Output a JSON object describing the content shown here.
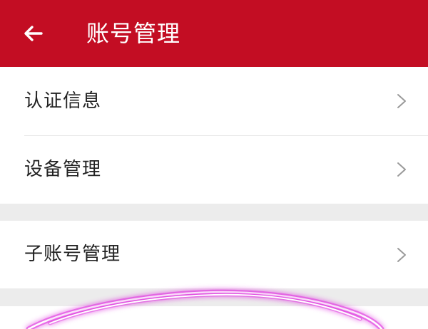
{
  "header": {
    "title": "账号管理",
    "back_icon": "arrow-left-icon",
    "background_color": "#c30d23"
  },
  "menu": {
    "group1": [
      {
        "label": "认证信息",
        "icon": "chevron-right-icon"
      },
      {
        "label": "设备管理",
        "icon": "chevron-right-icon"
      }
    ],
    "group2": [
      {
        "label": "子账号管理",
        "icon": "chevron-right-icon"
      }
    ]
  },
  "annotation": {
    "icon": "hand-drawn-circle-scribble",
    "color": "#e040e0"
  }
}
